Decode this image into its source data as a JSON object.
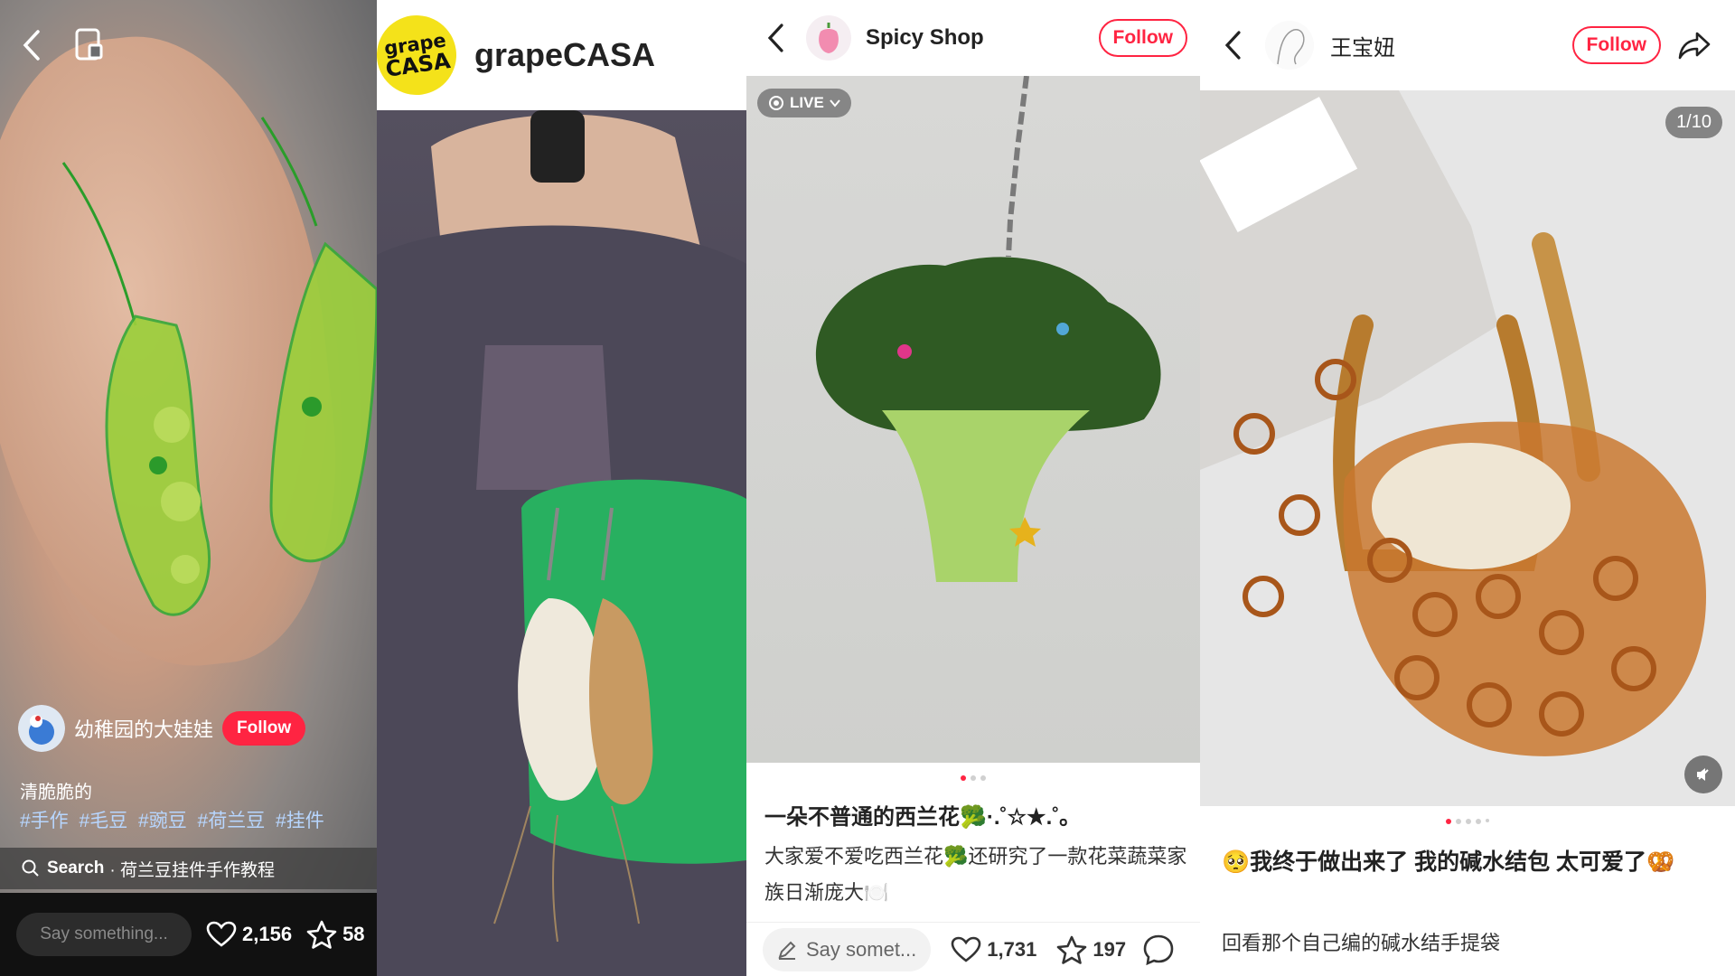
{
  "panel1": {
    "author": "幼稚园的大娃娃",
    "follow": "Follow",
    "caption": "清脆脆的",
    "tags": "#手作 #毛豆 #豌豆 #荷兰豆 #挂件",
    "search_label": "Search",
    "search_query": "· 荷兰豆挂件手作教程",
    "say_placeholder": "Say something...",
    "likes": "2,156",
    "stars": "58"
  },
  "panel2": {
    "logo_line1": "grape",
    "logo_line2": "CASA",
    "title": "grapeCASA"
  },
  "panel3": {
    "shop_name": "Spicy Shop",
    "follow": "Follow",
    "live_label": "LIVE",
    "title": "一朵不普通的西兰花🥦·.˚☆★.˚｡",
    "body": "大家爱不爱吃西兰花🥦还研究了一款花菜蔬菜家族日渐庞大🍽️",
    "say_placeholder": "Say somet...",
    "likes": "1,731",
    "stars": "197"
  },
  "panel4": {
    "author": "王宝妞",
    "follow": "Follow",
    "counter": "1/10",
    "title": "🥺我终于做出来了 我的碱水结包 太可爱了🥨",
    "body": "回看那个自己编的碱水结手提袋"
  },
  "colors": {
    "accent_red": "#ff2442",
    "tag_blue": "#b7d6ff"
  }
}
